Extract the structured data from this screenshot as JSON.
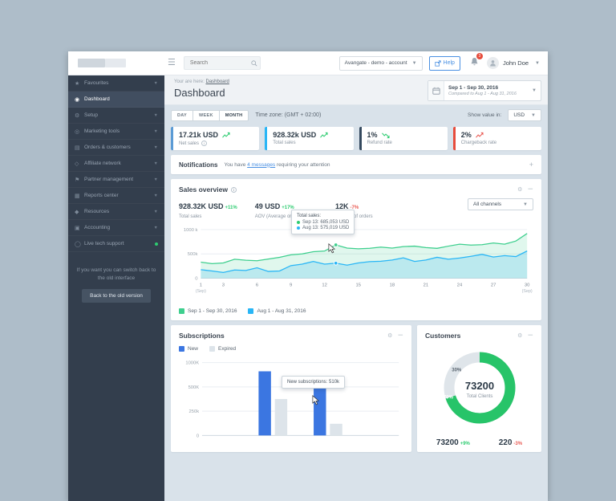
{
  "topbar": {
    "search_placeholder": "Search",
    "account_select": "Avangate - demo - account",
    "help_label": "Help",
    "notification_count": "3",
    "user_name": "John Doe"
  },
  "sidebar": {
    "items": [
      {
        "label": "Favourites",
        "icon": "star-icon",
        "glyph": "★",
        "caret": true,
        "active": false
      },
      {
        "label": "Dashboard",
        "icon": "dashboard-icon",
        "glyph": "◉",
        "caret": false,
        "active": true
      },
      {
        "label": "Setup",
        "icon": "setup-gear-icon",
        "glyph": "⚙",
        "caret": true,
        "active": false
      },
      {
        "label": "Marketing tools",
        "icon": "marketing-icon",
        "glyph": "◎",
        "caret": true,
        "active": false
      },
      {
        "label": "Orders & customers",
        "icon": "orders-icon",
        "glyph": "▤",
        "caret": true,
        "active": false
      },
      {
        "label": "Affiliate network",
        "icon": "affiliate-icon",
        "glyph": "◇",
        "caret": true,
        "active": false
      },
      {
        "label": "Partner management",
        "icon": "partner-icon",
        "glyph": "⚑",
        "caret": true,
        "active": false
      },
      {
        "label": "Reports center",
        "icon": "reports-icon",
        "glyph": "▦",
        "caret": true,
        "active": false
      },
      {
        "label": "Resources",
        "icon": "resources-icon",
        "glyph": "◆",
        "caret": true,
        "active": false
      },
      {
        "label": "Accounting",
        "icon": "accounting-icon",
        "glyph": "▣",
        "caret": true,
        "active": false
      },
      {
        "label": "Live tech support",
        "icon": "support-icon",
        "glyph": "◯",
        "caret": false,
        "active": false,
        "status_dot": true
      }
    ],
    "switch_note": "If you want you can switch back to the old interface",
    "back_button": "Back to the old version"
  },
  "header": {
    "breadcrumb_prefix": "Your are here:",
    "breadcrumb_link": "Dashboard",
    "title": "Dashboard",
    "date_range": "Sep 1 - Sep 30, 2016",
    "date_compare": "Compared to Aug 1 - Aug 31, 2016"
  },
  "toolbar": {
    "day": "DAY",
    "week": "WEEK",
    "month": "MONTH",
    "timezone": "Time zone: (GMT + 02:00)",
    "show_value_label": "Show value in:",
    "currency": "USD"
  },
  "kpis": [
    {
      "value": "17.21k USD",
      "label": "Net sales",
      "trend": "up-green",
      "border": "#5b9bd5",
      "has_info": true
    },
    {
      "value": "928.32k USD",
      "label": "Total sales",
      "trend": "up-green",
      "border": "#29b6f6",
      "has_info": false
    },
    {
      "value": "1%",
      "label": "Refund rate",
      "trend": "down-green",
      "border": "#34495e",
      "has_info": false
    },
    {
      "value": "2%",
      "label": "Chargeback rate",
      "trend": "up-red",
      "border": "#e74c3c",
      "has_info": false
    }
  ],
  "notifications": {
    "title": "Notifications",
    "text_prefix": "You have",
    "link_text": "4 messages",
    "text_suffix": "requiring your attention",
    "expand_icon": "+"
  },
  "sales_overview": {
    "title": "Sales overview",
    "stats": [
      {
        "value": "928.32K USD",
        "delta": "+11%",
        "delta_color": "green",
        "label": "Total sales"
      },
      {
        "value": "49 USD",
        "delta": "+17%",
        "delta_color": "green",
        "label": "AOV (Average order number)"
      },
      {
        "value": "12K",
        "delta": "-7%",
        "delta_color": "red",
        "label": "Number of orders"
      }
    ],
    "channel_select": "All channels",
    "tooltip": {
      "title": "Total sales:",
      "rows": [
        {
          "dot_color": "#2ecc71",
          "text": "Sep 13: 685,053 USD"
        },
        {
          "dot_color": "#29b6f6",
          "text": "Aug 13: 575,019 USD"
        }
      ]
    }
  },
  "subscriptions": {
    "title": "Subscriptions",
    "tooltip": "New subscriptions: 510k"
  },
  "customers": {
    "title": "Customers",
    "center_value": "73200",
    "center_label": "Total Clients",
    "stats": [
      {
        "value": "73200",
        "delta": "+9%",
        "delta_color": "green"
      },
      {
        "value": "220",
        "delta": "-3%",
        "delta_color": "red"
      }
    ]
  },
  "chart_data": [
    {
      "id": "sales",
      "type": "area",
      "title": "Sales overview",
      "xlabel": "",
      "ylabel": "",
      "x_range": [
        1,
        30
      ],
      "x_ticks": [
        1,
        3,
        6,
        9,
        12,
        15,
        18,
        21,
        24,
        27,
        30
      ],
      "x_sublabel": "(Sep)",
      "ylim": [
        0,
        1000
      ],
      "y_ticks": [
        {
          "v": 1000,
          "label": "1000 k"
        },
        {
          "v": 500,
          "label": "500k"
        },
        {
          "v": 0,
          "label": "0"
        }
      ],
      "legend_position": "bottom",
      "grid": true,
      "series": [
        {
          "name": "Sep 1 - Sep 30, 2016",
          "color": "#3ecf8e",
          "fill": "rgba(62,207,142,0.16)",
          "marker_x": 13,
          "values": [
            330,
            300,
            315,
            390,
            370,
            360,
            395,
            430,
            480,
            500,
            545,
            560,
            685,
            620,
            605,
            615,
            640,
            620,
            650,
            660,
            630,
            615,
            660,
            700,
            680,
            690,
            725,
            700,
            765,
            920
          ]
        },
        {
          "name": "Aug 1 - Aug 31, 2016",
          "color": "#29b6f6",
          "fill": "rgba(41,182,246,0.20)",
          "marker_x": 13,
          "values": [
            175,
            150,
            120,
            170,
            160,
            215,
            140,
            150,
            260,
            290,
            345,
            290,
            310,
            270,
            315,
            340,
            350,
            375,
            420,
            345,
            375,
            430,
            390,
            415,
            450,
            490,
            435,
            465,
            445,
            560
          ]
        }
      ]
    },
    {
      "id": "subscriptions",
      "type": "bar",
      "title": "Subscriptions",
      "categories": [
        "",
        ""
      ],
      "y_ticks": [
        {
          "v": 1000,
          "label": "1000K"
        },
        {
          "v": 500,
          "label": "500K"
        },
        {
          "v": 250,
          "label": "250k"
        },
        {
          "v": 0,
          "label": "0"
        }
      ],
      "grid": true,
      "legend_position": "top",
      "series": [
        {
          "name": "New",
          "color": "#3b76e1",
          "values": [
            820,
            510
          ]
        },
        {
          "name": "Expired",
          "color": "#dde4ea",
          "values": [
            375,
            120
          ]
        }
      ],
      "group_positions": [
        0.36,
        0.64
      ]
    },
    {
      "id": "customers",
      "type": "pie",
      "title": "Customers",
      "center_value": "73200",
      "center_label": "Total Clients",
      "slices": [
        {
          "label": "70%",
          "value": 70,
          "color": "#27c469",
          "label_color": "#ffffff"
        },
        {
          "label": "30%",
          "value": 30,
          "color": "#dfe5ea",
          "label_color": "#5a6570"
        }
      ]
    }
  ],
  "colors": {
    "accent_blue": "#4a90e2",
    "green": "#2ecc71",
    "chart_blue": "#29b6f6",
    "red": "#e74c3c",
    "sidebar_bg": "#333e4d",
    "desktop_bg": "#aebdc9",
    "content_bg": "#d9e2ea"
  }
}
